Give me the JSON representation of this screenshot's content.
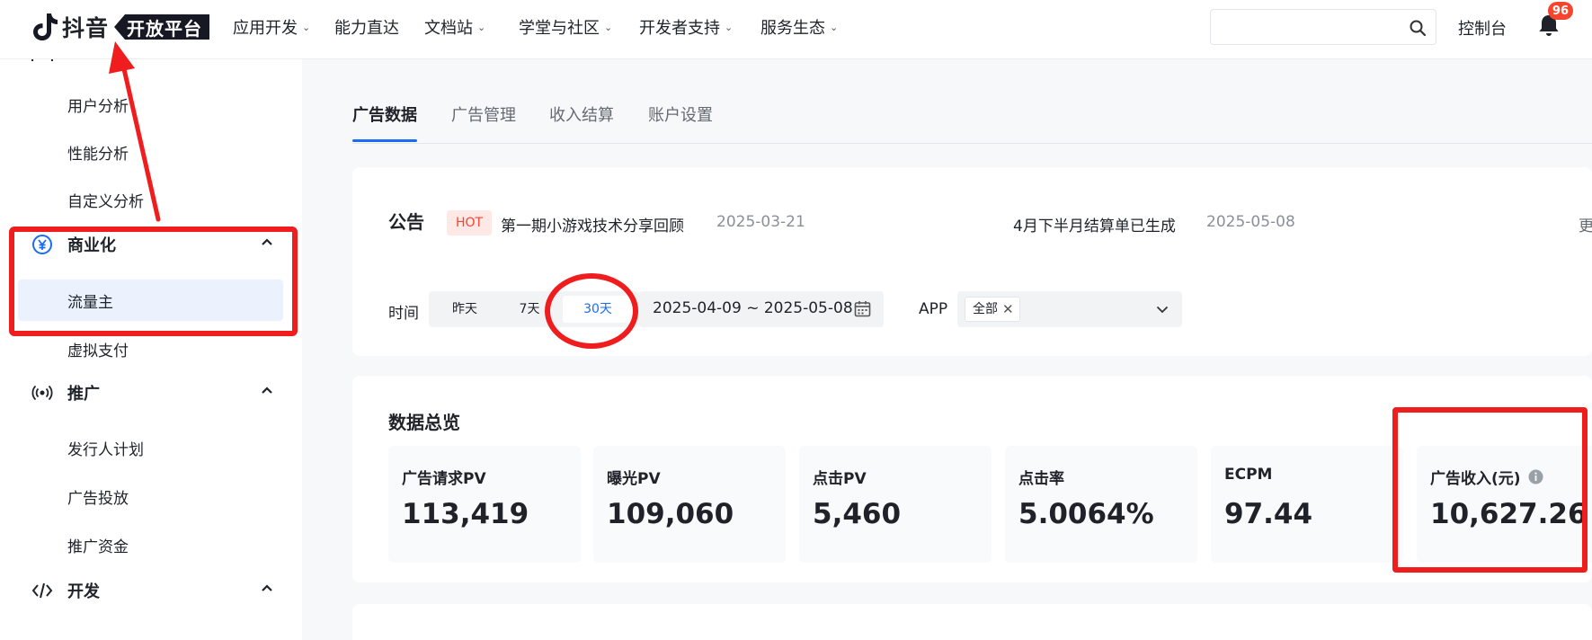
{
  "header": {
    "logo_name": "抖音",
    "logo_badge": "开放平台",
    "nav": [
      {
        "label": "应用开发",
        "has_menu": true
      },
      {
        "label": "能力直达",
        "has_menu": false
      },
      {
        "label": "文档站",
        "has_menu": true
      },
      {
        "label": "学堂与社区",
        "has_menu": true
      },
      {
        "label": "开发者支持",
        "has_menu": true
      },
      {
        "label": "服务生态",
        "has_menu": true
      }
    ],
    "search": {
      "value": "",
      "placeholder": ""
    },
    "console_label": "控制台",
    "notification_count": "96"
  },
  "sidebar": {
    "items_top": [
      "用户分析",
      "性能分析",
      "自定义分析"
    ],
    "groups": [
      {
        "label": "商业化",
        "icon": "yen-circle-icon",
        "expanded": true,
        "items": [
          "流量主",
          "虚拟支付"
        ],
        "active_item": "流量主"
      },
      {
        "label": "推广",
        "icon": "broadcast-icon",
        "expanded": true,
        "items": [
          "发行人计划",
          "广告投放",
          "推广资金"
        ]
      },
      {
        "label": "开发",
        "icon": "code-icon",
        "expanded": true,
        "items": []
      }
    ]
  },
  "main": {
    "tabs": [
      {
        "label": "广告数据",
        "active": true
      },
      {
        "label": "广告管理",
        "active": false
      },
      {
        "label": "收入结算",
        "active": false
      },
      {
        "label": "账户设置",
        "active": false
      }
    ],
    "notice": {
      "title": "公告",
      "hot_badge": "HOT",
      "items": [
        {
          "text": "第一期小游戏技术分享回顾",
          "date": "2025-03-21"
        },
        {
          "text": "4月下半月结算单已生成",
          "date": "2025-05-08"
        }
      ],
      "more": "更"
    },
    "filter": {
      "time_label": "时间",
      "time_options": [
        "昨天",
        "7天",
        "30天"
      ],
      "active_time": "30天",
      "date_range": "2025-04-09 ~ 2025-05-08",
      "app_label": "APP",
      "app_chip": "全部"
    },
    "overview": {
      "title": "数据总览",
      "metrics": [
        {
          "label": "广告请求PV",
          "value": "113,419"
        },
        {
          "label": "曝光PV",
          "value": "109,060"
        },
        {
          "label": "点击PV",
          "value": "5,460"
        },
        {
          "label": "点击率",
          "value": "5.0064%"
        },
        {
          "label": "ECPM",
          "value": "97.44"
        },
        {
          "label": "广告收入(元)",
          "value": "10,627.26",
          "info": true
        }
      ]
    }
  },
  "colors": {
    "accent": "#1a6cf5",
    "annotation": "#ef1d1d",
    "hot": "#f5452e",
    "active_bg": "#ebf2fd"
  }
}
